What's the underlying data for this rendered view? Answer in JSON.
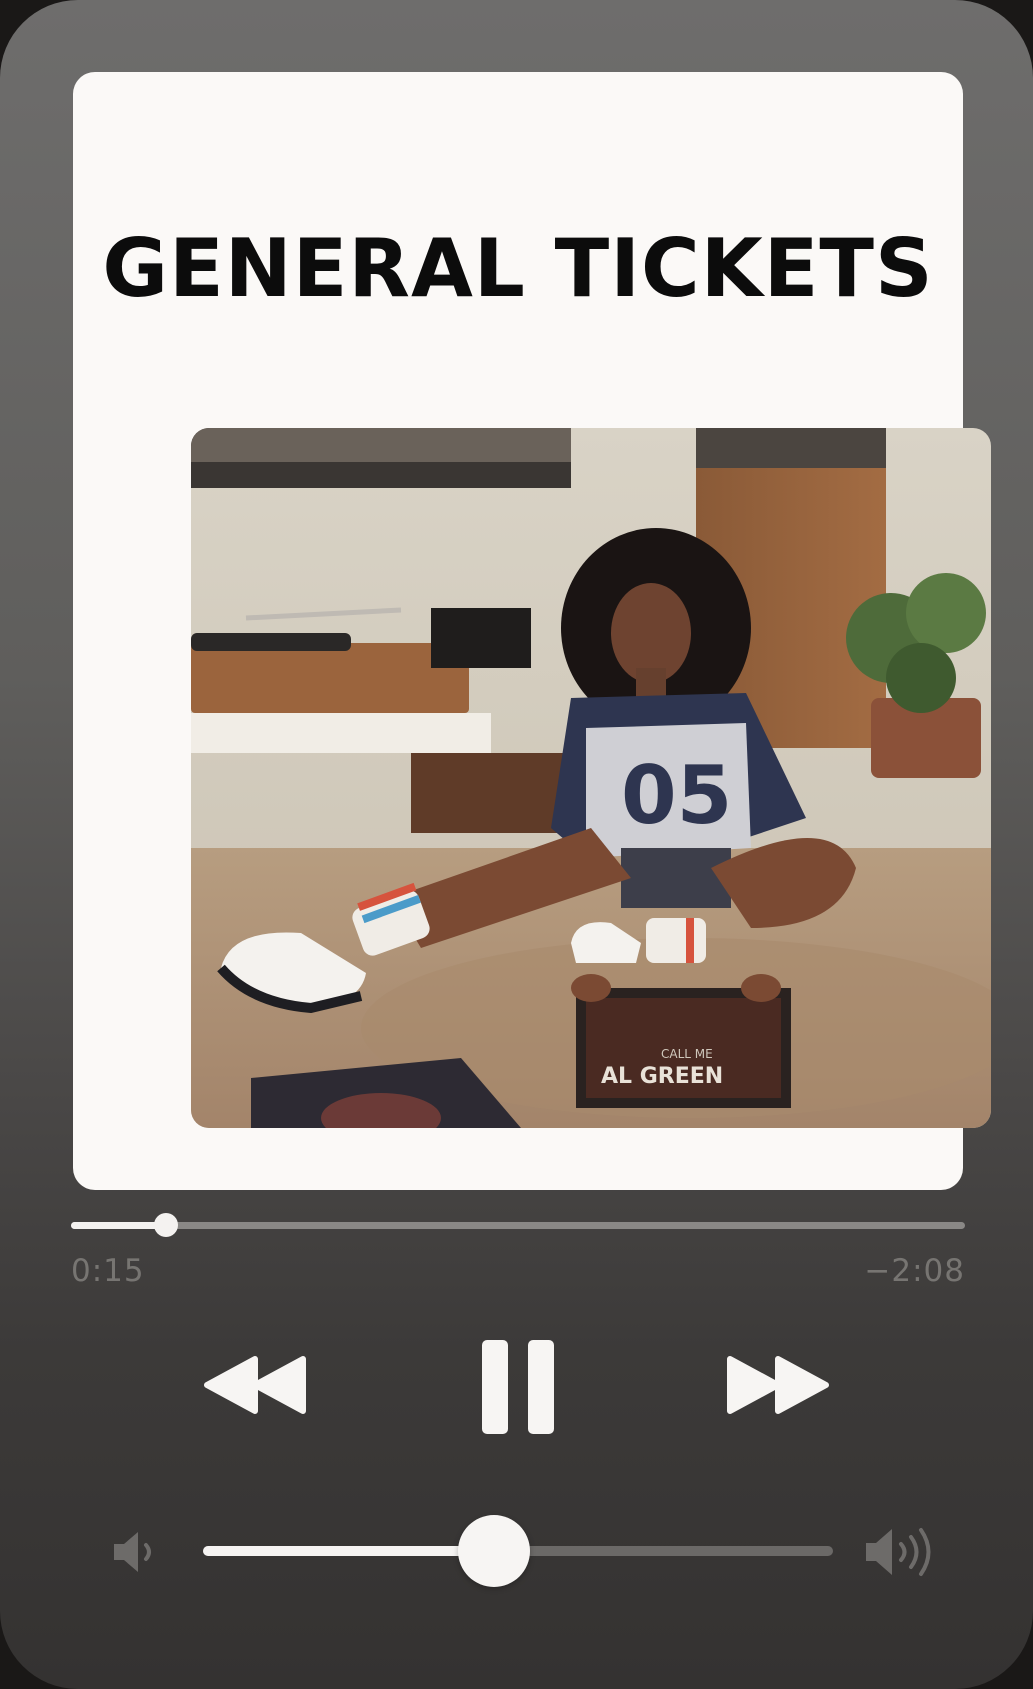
{
  "card": {
    "title": "GENERAL TICKETS"
  },
  "artwork": {
    "record_label_text": "AL GREEN",
    "record_sublabel_text": "CALL ME",
    "jersey_number": "05"
  },
  "playback": {
    "elapsed": "0:15",
    "remaining": "−2:08",
    "progress_fraction": 0.106,
    "state": "playing"
  },
  "controls": {
    "rewind_icon": "rewind-icon",
    "pause_icon": "pause-icon",
    "forward_icon": "fast-forward-icon"
  },
  "volume": {
    "level_fraction": 0.462,
    "low_icon": "speaker-low-icon",
    "high_icon": "speaker-high-icon"
  },
  "colors": {
    "card_background": "#fbf9f7",
    "title_color": "#0c0c0c",
    "control_color": "#f7f5f3",
    "muted_text": "#777572"
  }
}
